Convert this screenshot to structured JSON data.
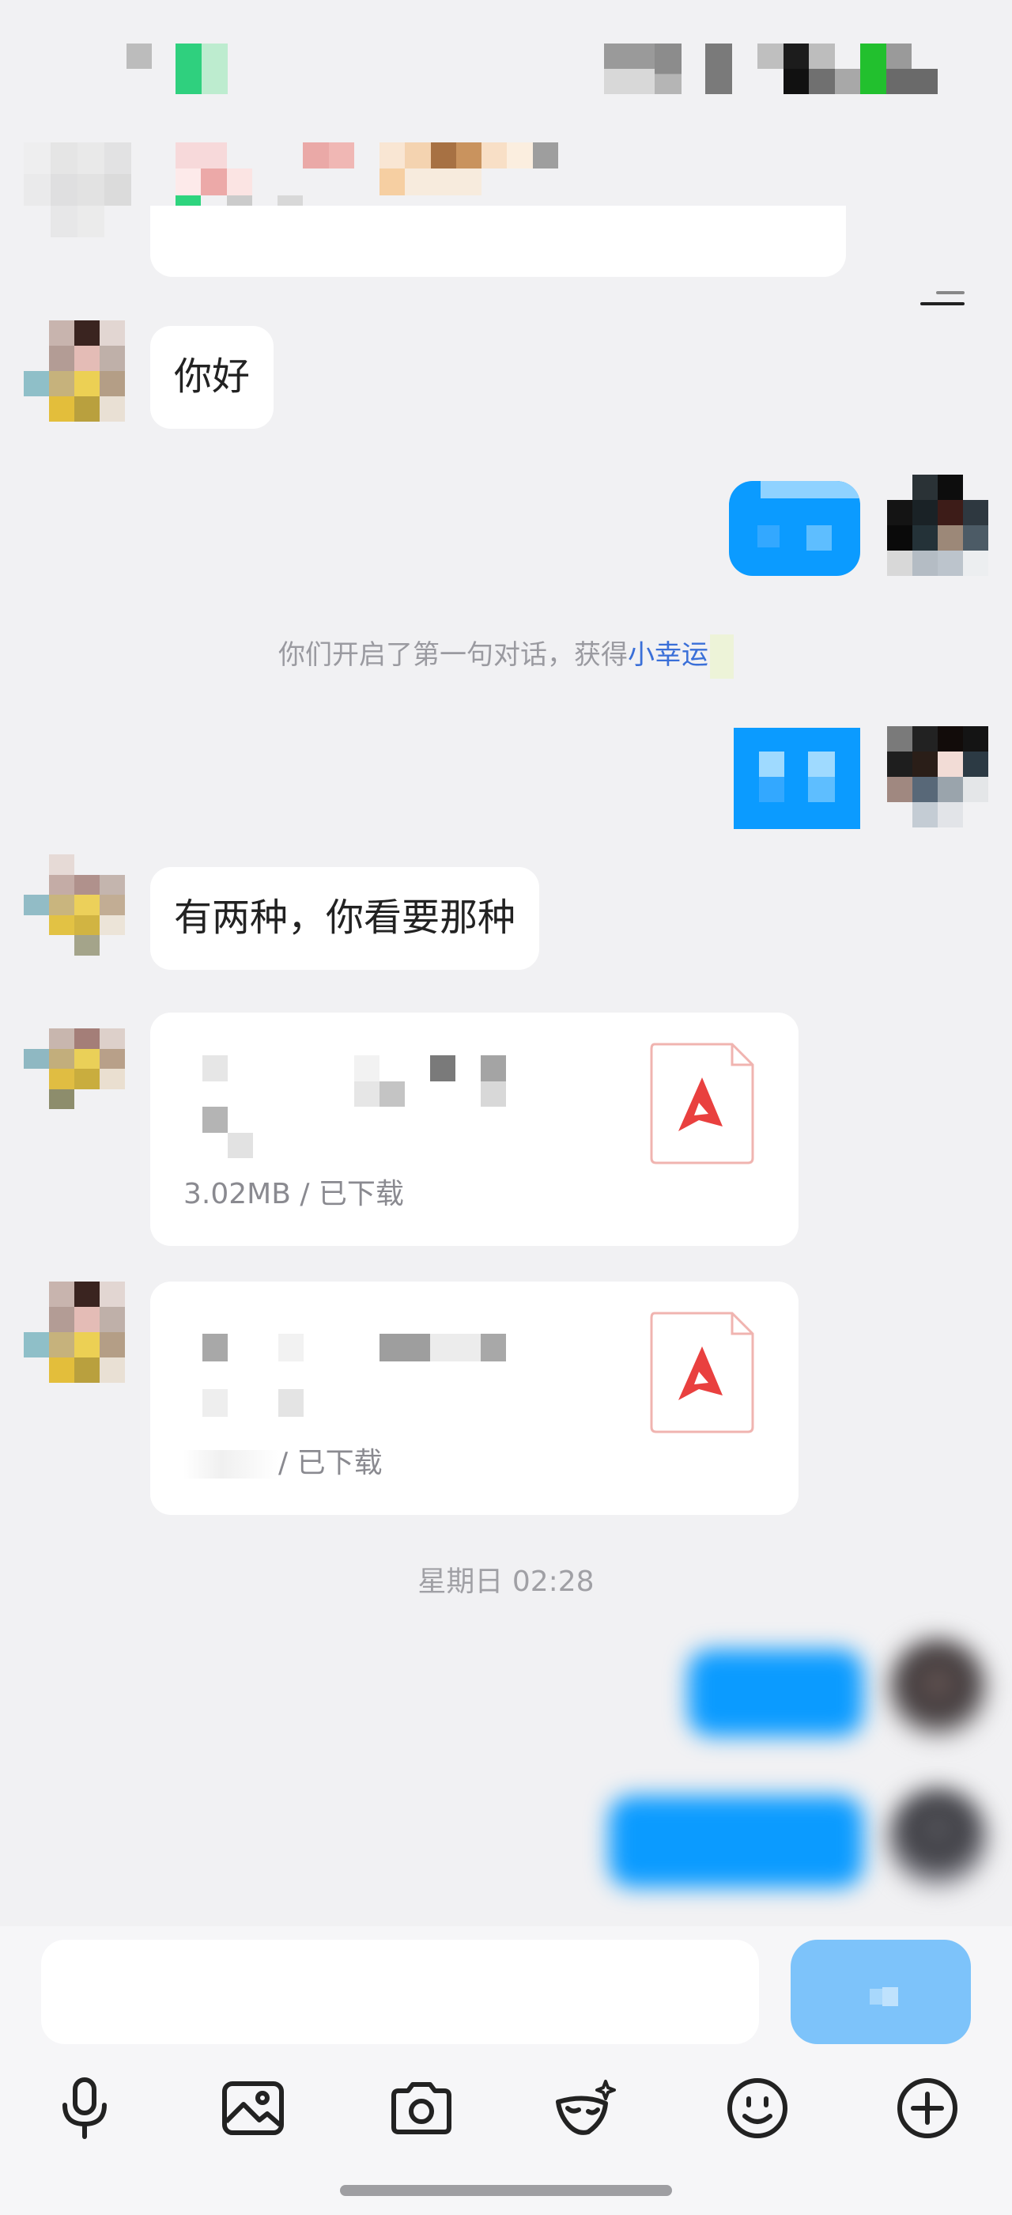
{
  "conversation": {
    "messages": [
      {
        "side": "left",
        "type": "text",
        "text": "你好"
      },
      {
        "side": "right",
        "type": "censored"
      },
      {
        "side": "system",
        "type": "system",
        "text_prefix": "你们开启了第一句对话，获得",
        "text_link": "小幸运"
      },
      {
        "side": "right",
        "type": "censored"
      },
      {
        "side": "left",
        "type": "text",
        "text": "有两种，你看要那种"
      },
      {
        "side": "left",
        "type": "file",
        "meta": "3.02MB / 已下载",
        "file_type": "pdf"
      },
      {
        "side": "left",
        "type": "file",
        "meta": "/ 已下载",
        "file_type": "pdf"
      },
      {
        "side": "divider",
        "type": "time",
        "text": "星期日 02:28"
      },
      {
        "side": "right",
        "type": "blurred"
      },
      {
        "side": "right",
        "type": "blurred"
      }
    ]
  },
  "toolbar": {
    "icons": [
      "microphone-icon",
      "image-icon",
      "camera-icon",
      "mask-sparkle-icon",
      "emoji-icon",
      "plus-icon"
    ]
  },
  "colors": {
    "background": "#f1f1f3",
    "outgoing_bubble": "#0b9bff",
    "send_button": "#7dc3fa",
    "link": "#3a6fd8",
    "pdf_red": "#e9403f"
  }
}
